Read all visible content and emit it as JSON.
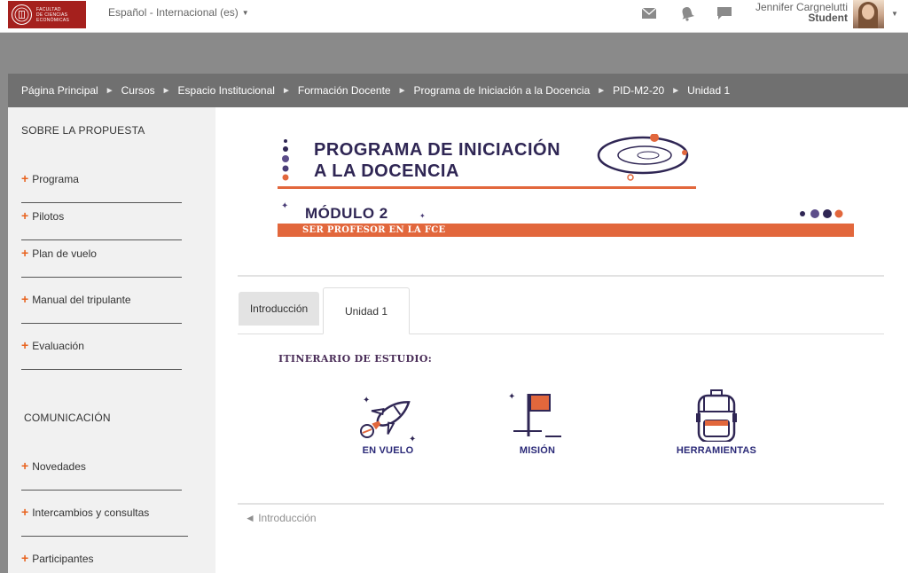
{
  "header": {
    "logo_lines": [
      "FACULTAD",
      "DE CIENCIAS",
      "ECONÓMICAS"
    ],
    "language": "Español - Internacional (es)",
    "icons": [
      "envelope-icon",
      "bell-icon",
      "chat-icon"
    ],
    "user": {
      "name": "Jennifer Cargnelutti",
      "role": "Student"
    }
  },
  "breadcrumb": [
    "Página Principal",
    "Cursos",
    "Espacio Institucional",
    "Formación Docente",
    "Programa de Iniciación a la Docencia",
    "PID-M2-20",
    "Unidad 1"
  ],
  "sidebar": {
    "section1_title": "SOBRE LA PROPUESTA",
    "section1_items": [
      "Programa",
      "Pilotos",
      "Plan de vuelo",
      "Manual del tripulante",
      "Evaluación"
    ],
    "section2_title": "COMUNICACIÓN",
    "section2_items": [
      "Novedades",
      "Intercambios y consultas",
      "Participantes"
    ]
  },
  "banner": {
    "title_line1": "PROGRAMA DE INICIACIÓN",
    "title_line2": "A LA DOCENCIA",
    "module": "MÓDULO 2",
    "subtitle": "SER PROFESOR EN LA FCE"
  },
  "tabs": [
    "Introducción",
    "Unidad 1"
  ],
  "active_tab": "Unidad 1",
  "content": {
    "itinerary_label": "ITINERARIO DE ESTUDIO:",
    "features": [
      {
        "label": "EN VUELO",
        "icon": "rocket-icon"
      },
      {
        "label": "MISIÓN",
        "icon": "flag-icon"
      },
      {
        "label": "HERRAMIENTAS",
        "icon": "backpack-icon"
      }
    ],
    "prev_link": "◄ Introducción"
  },
  "colors": {
    "brand_red": "#a5201d",
    "accent_orange": "#e2673c",
    "navy": "#2f2654",
    "link_blue": "#2b2a78"
  }
}
